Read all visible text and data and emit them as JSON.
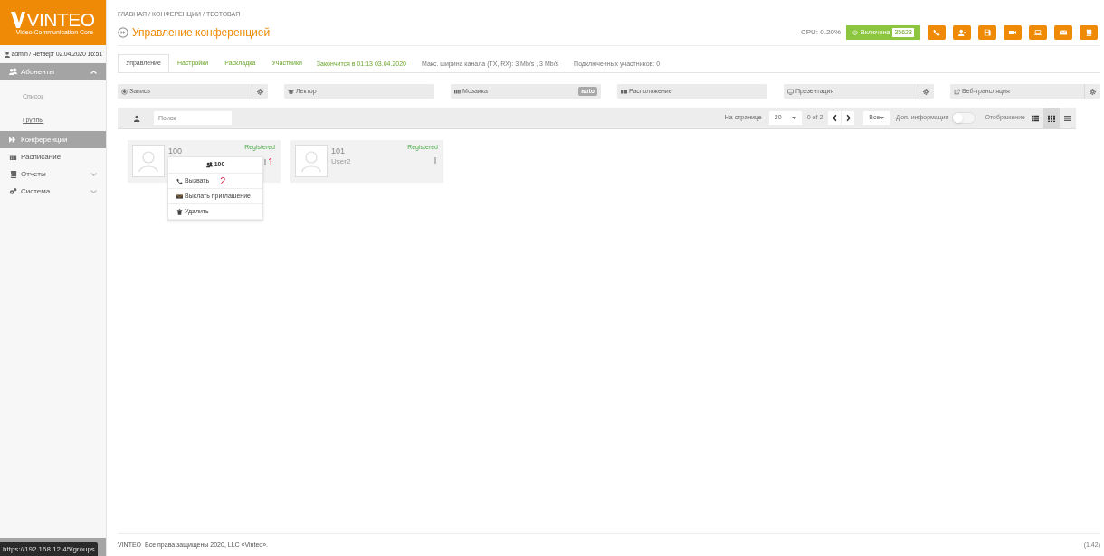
{
  "brand": {
    "name": "VINTEO",
    "tagline": "Video Communication Core"
  },
  "user_line": "admin / Четверг 02.04.2020 16:51",
  "sidebar": {
    "items": [
      {
        "label": "Абоненты",
        "selected": true,
        "expanded": true,
        "children": [
          {
            "label": "Список",
            "selected": false
          },
          {
            "label": "Группы",
            "selected": true
          }
        ]
      },
      {
        "label": "Конференции",
        "selected": true
      },
      {
        "label": "Расписание",
        "selected": false
      },
      {
        "label": "Отчеты",
        "selected": false,
        "expanded": false
      },
      {
        "label": "Система",
        "selected": false,
        "expanded": false
      }
    ]
  },
  "breadcrumb": "ГЛАВНАЯ / КОНФЕРЕНЦИИ / ТЕСТОВАЯ",
  "title": "Управление конференцией",
  "cpu": "CPU: 0.20%",
  "status_button": {
    "label": "Включена",
    "code": "35623",
    "on": true
  },
  "tabs": [
    {
      "label": "Управление",
      "selected": true
    },
    {
      "label": "Настройки",
      "selected": false
    },
    {
      "label": "Раскладка",
      "selected": false
    },
    {
      "label": "Участники",
      "selected": false
    }
  ],
  "tab_info": [
    {
      "text": "Закончится в 01:13 03.04.2020",
      "kind": "accent"
    },
    {
      "text": "Макс. ширина канала (TX, RX): 3 Mb/s , 3 Mb/s",
      "kind": "plain"
    },
    {
      "text": "Подключенных участников: 0",
      "kind": "plain"
    }
  ],
  "controls": [
    {
      "label": "Запись",
      "gear": true
    },
    {
      "label": "Лектор",
      "gear": false
    },
    {
      "label": "Мозаика",
      "badge": "auto",
      "gear": false
    },
    {
      "label": "Расположение",
      "gear": false
    },
    {
      "label": "Презентация",
      "gear": true
    },
    {
      "label": "Веб-трансляция",
      "gear": true
    }
  ],
  "toolbar": {
    "search_placeholder": "Поиск",
    "per_page_label": "На странице",
    "per_page": "20",
    "page_info": "0 of 2",
    "filter": "Все",
    "extra_info_label": "Доп. информация",
    "extra_info_on": false,
    "view_label": "Отображение",
    "views": [
      {
        "selected": false
      },
      {
        "selected": true
      },
      {
        "selected": false
      }
    ]
  },
  "participants": [
    {
      "number": "100",
      "status": "Registered",
      "annotation": "1"
    },
    {
      "number": "101",
      "name": "User2",
      "status": "Registered"
    }
  ],
  "context_menu": {
    "header": "100",
    "items": [
      {
        "label": "Вызвать",
        "annotation": "2"
      },
      {
        "label": "Выслать приглашение"
      },
      {
        "label": "Удалить"
      }
    ]
  },
  "footer": {
    "brand": "VINTEO",
    "text": "Все права защищены 2020, LLC «Vinteo».",
    "version": "(1.42)"
  },
  "status_url": "https://192.168.12.45/groups"
}
